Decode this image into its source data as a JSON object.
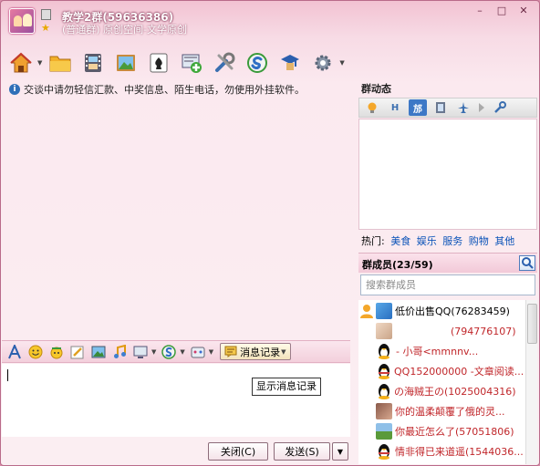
{
  "window": {
    "group_name": "教学2群(59636386)",
    "group_subtitle": "(普通群) 原创空间-文学原创",
    "minimize": "–",
    "maximize": "□",
    "close": "✕"
  },
  "toolbar": {
    "icons": [
      "home-icon",
      "folder-icon",
      "film-icon",
      "picture-icon",
      "game-icon",
      "add-app-icon",
      "tools-icon",
      "soso-icon",
      "campus-icon",
      "settings-icon"
    ]
  },
  "notice": "交谈中请勿轻信汇款、中奖信息、陌生电话，勿使用外挂软件。",
  "format_bar": {
    "history_label": "消息记录"
  },
  "tooltip": "显示消息记录",
  "buttons": {
    "close": "关闭(C)",
    "send": "发送(S)"
  },
  "group_dynamics": {
    "title": "群动态",
    "tabs": [
      "H",
      "邡"
    ]
  },
  "hot": {
    "label": "热门:",
    "links": [
      "美食",
      "娱乐",
      "服务",
      "购物",
      "其他"
    ]
  },
  "members": {
    "title": "群成员(23/59)",
    "search_placeholder": "搜索群成员",
    "list": [
      {
        "name": "低价出售QQ(76283459)",
        "color": "#000000"
      },
      {
        "name": "(794776107)",
        "color": "#c0262a"
      },
      {
        "name": "-                    小哥<mmnnv...",
        "color": "#c0262a"
      },
      {
        "name": "QQ152000000 -文章阅读...",
        "color": "#c0262a"
      },
      {
        "name": "の海贼王の(1025004316)",
        "color": "#c0262a"
      },
      {
        "name": "你的温柔颠覆了俄的灵...",
        "color": "#c0262a"
      },
      {
        "name": "你最近怎么了(57051806)",
        "color": "#c0262a"
      },
      {
        "name": "情非得已来道遥(1544036...",
        "color": "#c0262a"
      }
    ]
  }
}
